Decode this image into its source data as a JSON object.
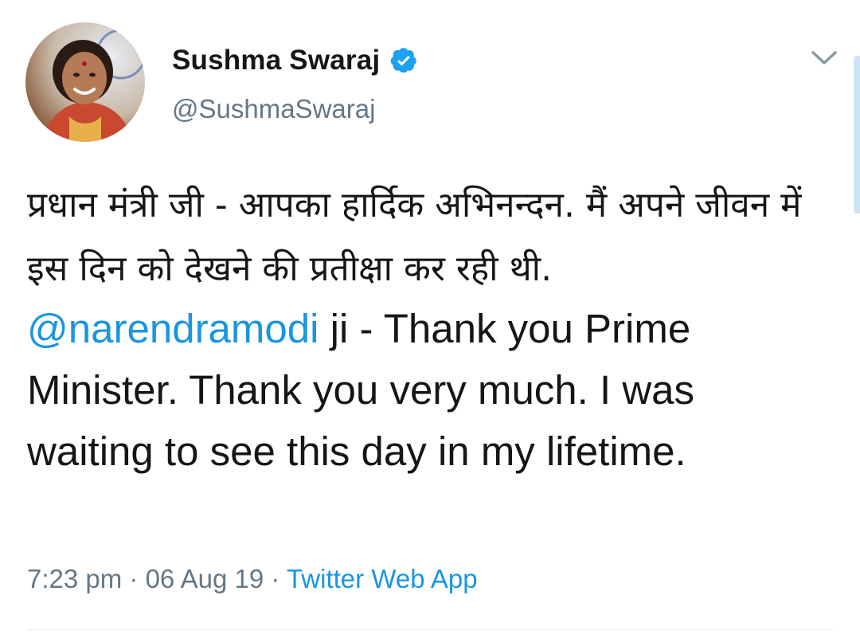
{
  "author": {
    "display_name": "Sushma Swaraj",
    "handle": "@SushmaSwaraj",
    "verified_icon": "verified-badge-icon",
    "avatar_icon": "profile-photo"
  },
  "menu": {
    "icon": "chevron-down-icon"
  },
  "tweet": {
    "hindi_text": "प्रधान मंत्री जी - आपका हार्दिक अभिनन्दन. मैं अपने जीवन में इस दिन को देखने की प्रतीक्षा कर रही थी.",
    "mention": "@narendramodi",
    "english_text": " ji - Thank you Prime Minister. Thank you very much. I was waiting to see this day in my lifetime."
  },
  "meta": {
    "time": "7:23 pm",
    "separator1": " · ",
    "date": "06 Aug 19",
    "separator2": " · ",
    "source": "Twitter Web App"
  },
  "colors": {
    "link": "#1b95e0",
    "muted": "#657786",
    "text": "#14171a",
    "verified": "#1da1f2"
  }
}
